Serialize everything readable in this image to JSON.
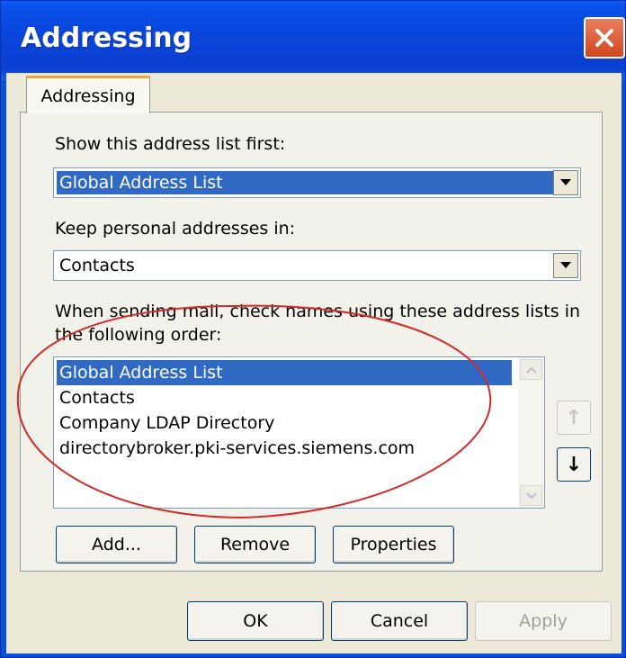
{
  "window": {
    "title": "Addressing"
  },
  "tabs": [
    {
      "label": "Addressing"
    }
  ],
  "show_first": {
    "label": "Show this address list first:",
    "value": "Global Address List"
  },
  "keep_personal": {
    "label": "Keep personal addresses in:",
    "value": "Contacts"
  },
  "check_names": {
    "label_line1": "When sending mail, check names using these address lists in",
    "label_line2": "the following order:",
    "items": [
      {
        "label": "Global Address List",
        "selected": true
      },
      {
        "label": "Contacts"
      },
      {
        "label": "Company LDAP Directory"
      },
      {
        "label": "directorybroker.pki-services.siemens.com"
      }
    ],
    "move_up_symbol": "↑",
    "move_down_symbol": "↓"
  },
  "list_buttons": {
    "add": "Add...",
    "remove": "Remove",
    "properties": "Properties"
  },
  "dialog_buttons": {
    "ok": "OK",
    "cancel": "Cancel",
    "apply": "Apply"
  },
  "annotation": {
    "shape": "red hand-drawn ellipse around the address list",
    "color": "#d22b2b"
  },
  "colors": {
    "selection": "#316ac5",
    "titlebar": "#0a4fd6",
    "face": "#ece9d8"
  }
}
